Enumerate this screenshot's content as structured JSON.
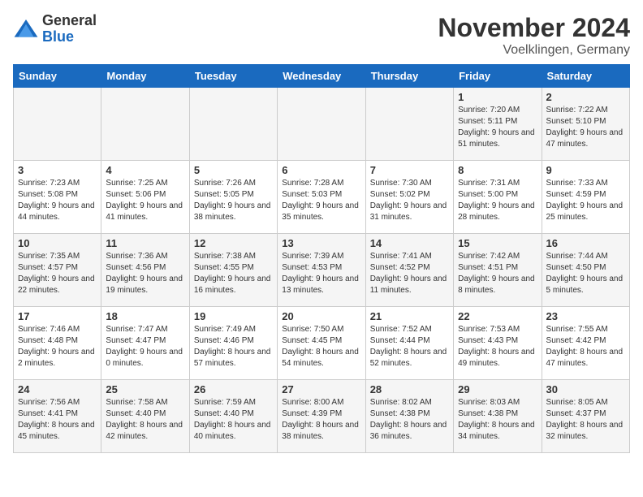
{
  "logo": {
    "general": "General",
    "blue": "Blue"
  },
  "title": "November 2024",
  "location": "Voelklingen, Germany",
  "weekdays": [
    "Sunday",
    "Monday",
    "Tuesday",
    "Wednesday",
    "Thursday",
    "Friday",
    "Saturday"
  ],
  "rows": [
    [
      {
        "day": "",
        "sunrise": "",
        "sunset": "",
        "daylight": ""
      },
      {
        "day": "",
        "sunrise": "",
        "sunset": "",
        "daylight": ""
      },
      {
        "day": "",
        "sunrise": "",
        "sunset": "",
        "daylight": ""
      },
      {
        "day": "",
        "sunrise": "",
        "sunset": "",
        "daylight": ""
      },
      {
        "day": "",
        "sunrise": "",
        "sunset": "",
        "daylight": ""
      },
      {
        "day": "1",
        "sunrise": "Sunrise: 7:20 AM",
        "sunset": "Sunset: 5:11 PM",
        "daylight": "Daylight: 9 hours and 51 minutes."
      },
      {
        "day": "2",
        "sunrise": "Sunrise: 7:22 AM",
        "sunset": "Sunset: 5:10 PM",
        "daylight": "Daylight: 9 hours and 47 minutes."
      }
    ],
    [
      {
        "day": "3",
        "sunrise": "Sunrise: 7:23 AM",
        "sunset": "Sunset: 5:08 PM",
        "daylight": "Daylight: 9 hours and 44 minutes."
      },
      {
        "day": "4",
        "sunrise": "Sunrise: 7:25 AM",
        "sunset": "Sunset: 5:06 PM",
        "daylight": "Daylight: 9 hours and 41 minutes."
      },
      {
        "day": "5",
        "sunrise": "Sunrise: 7:26 AM",
        "sunset": "Sunset: 5:05 PM",
        "daylight": "Daylight: 9 hours and 38 minutes."
      },
      {
        "day": "6",
        "sunrise": "Sunrise: 7:28 AM",
        "sunset": "Sunset: 5:03 PM",
        "daylight": "Daylight: 9 hours and 35 minutes."
      },
      {
        "day": "7",
        "sunrise": "Sunrise: 7:30 AM",
        "sunset": "Sunset: 5:02 PM",
        "daylight": "Daylight: 9 hours and 31 minutes."
      },
      {
        "day": "8",
        "sunrise": "Sunrise: 7:31 AM",
        "sunset": "Sunset: 5:00 PM",
        "daylight": "Daylight: 9 hours and 28 minutes."
      },
      {
        "day": "9",
        "sunrise": "Sunrise: 7:33 AM",
        "sunset": "Sunset: 4:59 PM",
        "daylight": "Daylight: 9 hours and 25 minutes."
      }
    ],
    [
      {
        "day": "10",
        "sunrise": "Sunrise: 7:35 AM",
        "sunset": "Sunset: 4:57 PM",
        "daylight": "Daylight: 9 hours and 22 minutes."
      },
      {
        "day": "11",
        "sunrise": "Sunrise: 7:36 AM",
        "sunset": "Sunset: 4:56 PM",
        "daylight": "Daylight: 9 hours and 19 minutes."
      },
      {
        "day": "12",
        "sunrise": "Sunrise: 7:38 AM",
        "sunset": "Sunset: 4:55 PM",
        "daylight": "Daylight: 9 hours and 16 minutes."
      },
      {
        "day": "13",
        "sunrise": "Sunrise: 7:39 AM",
        "sunset": "Sunset: 4:53 PM",
        "daylight": "Daylight: 9 hours and 13 minutes."
      },
      {
        "day": "14",
        "sunrise": "Sunrise: 7:41 AM",
        "sunset": "Sunset: 4:52 PM",
        "daylight": "Daylight: 9 hours and 11 minutes."
      },
      {
        "day": "15",
        "sunrise": "Sunrise: 7:42 AM",
        "sunset": "Sunset: 4:51 PM",
        "daylight": "Daylight: 9 hours and 8 minutes."
      },
      {
        "day": "16",
        "sunrise": "Sunrise: 7:44 AM",
        "sunset": "Sunset: 4:50 PM",
        "daylight": "Daylight: 9 hours and 5 minutes."
      }
    ],
    [
      {
        "day": "17",
        "sunrise": "Sunrise: 7:46 AM",
        "sunset": "Sunset: 4:48 PM",
        "daylight": "Daylight: 9 hours and 2 minutes."
      },
      {
        "day": "18",
        "sunrise": "Sunrise: 7:47 AM",
        "sunset": "Sunset: 4:47 PM",
        "daylight": "Daylight: 9 hours and 0 minutes."
      },
      {
        "day": "19",
        "sunrise": "Sunrise: 7:49 AM",
        "sunset": "Sunset: 4:46 PM",
        "daylight": "Daylight: 8 hours and 57 minutes."
      },
      {
        "day": "20",
        "sunrise": "Sunrise: 7:50 AM",
        "sunset": "Sunset: 4:45 PM",
        "daylight": "Daylight: 8 hours and 54 minutes."
      },
      {
        "day": "21",
        "sunrise": "Sunrise: 7:52 AM",
        "sunset": "Sunset: 4:44 PM",
        "daylight": "Daylight: 8 hours and 52 minutes."
      },
      {
        "day": "22",
        "sunrise": "Sunrise: 7:53 AM",
        "sunset": "Sunset: 4:43 PM",
        "daylight": "Daylight: 8 hours and 49 minutes."
      },
      {
        "day": "23",
        "sunrise": "Sunrise: 7:55 AM",
        "sunset": "Sunset: 4:42 PM",
        "daylight": "Daylight: 8 hours and 47 minutes."
      }
    ],
    [
      {
        "day": "24",
        "sunrise": "Sunrise: 7:56 AM",
        "sunset": "Sunset: 4:41 PM",
        "daylight": "Daylight: 8 hours and 45 minutes."
      },
      {
        "day": "25",
        "sunrise": "Sunrise: 7:58 AM",
        "sunset": "Sunset: 4:40 PM",
        "daylight": "Daylight: 8 hours and 42 minutes."
      },
      {
        "day": "26",
        "sunrise": "Sunrise: 7:59 AM",
        "sunset": "Sunset: 4:40 PM",
        "daylight": "Daylight: 8 hours and 40 minutes."
      },
      {
        "day": "27",
        "sunrise": "Sunrise: 8:00 AM",
        "sunset": "Sunset: 4:39 PM",
        "daylight": "Daylight: 8 hours and 38 minutes."
      },
      {
        "day": "28",
        "sunrise": "Sunrise: 8:02 AM",
        "sunset": "Sunset: 4:38 PM",
        "daylight": "Daylight: 8 hours and 36 minutes."
      },
      {
        "day": "29",
        "sunrise": "Sunrise: 8:03 AM",
        "sunset": "Sunset: 4:38 PM",
        "daylight": "Daylight: 8 hours and 34 minutes."
      },
      {
        "day": "30",
        "sunrise": "Sunrise: 8:05 AM",
        "sunset": "Sunset: 4:37 PM",
        "daylight": "Daylight: 8 hours and 32 minutes."
      }
    ]
  ]
}
